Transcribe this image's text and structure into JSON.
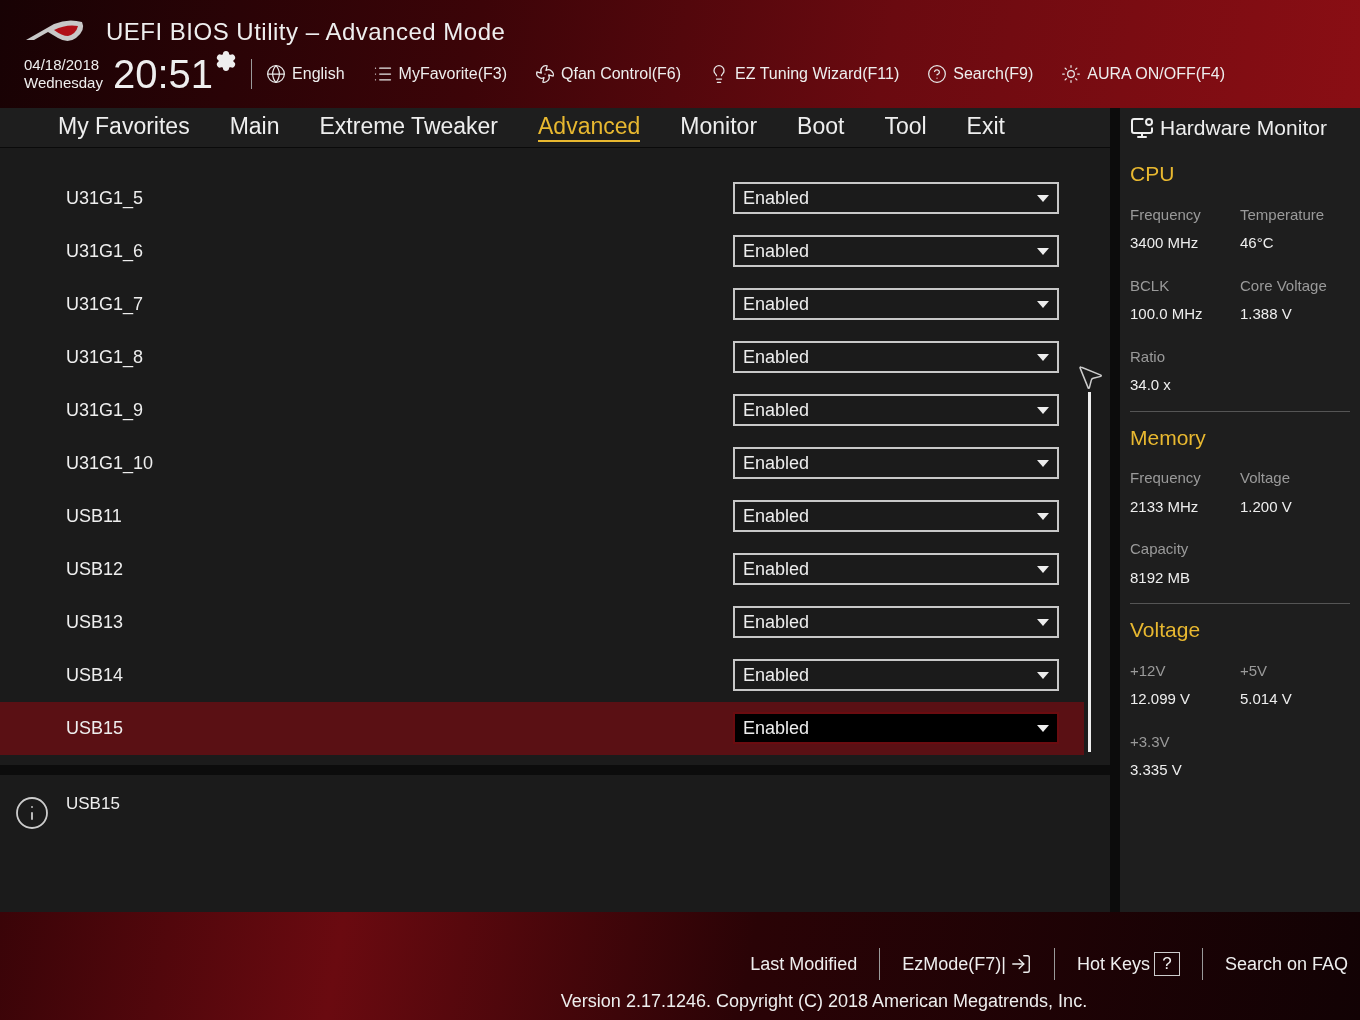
{
  "header": {
    "title": "UEFI BIOS Utility – Advanced Mode",
    "date": "04/18/2018",
    "weekday": "Wednesday",
    "time": "20:51",
    "toolbar": [
      {
        "kind": "globe",
        "label": "English"
      },
      {
        "kind": "favorite",
        "label": "MyFavorite(F3)"
      },
      {
        "kind": "fan",
        "label": "Qfan Control(F6)"
      },
      {
        "kind": "bulb",
        "label": "EZ Tuning Wizard(F11)"
      },
      {
        "kind": "search",
        "label": "Search(F9)"
      },
      {
        "kind": "aura",
        "label": "AURA ON/OFF(F4)"
      }
    ]
  },
  "tabs": [
    {
      "label": "My Favorites",
      "selected": false
    },
    {
      "label": "Main",
      "selected": false
    },
    {
      "label": "Extreme Tweaker",
      "selected": false
    },
    {
      "label": "Advanced",
      "selected": true
    },
    {
      "label": "Monitor",
      "selected": false
    },
    {
      "label": "Boot",
      "selected": false
    },
    {
      "label": "Tool",
      "selected": false
    },
    {
      "label": "Exit",
      "selected": false
    }
  ],
  "settings": [
    {
      "label": "U31G1_5",
      "value": "Enabled",
      "selected": false
    },
    {
      "label": "U31G1_6",
      "value": "Enabled",
      "selected": false
    },
    {
      "label": "U31G1_7",
      "value": "Enabled",
      "selected": false
    },
    {
      "label": "U31G1_8",
      "value": "Enabled",
      "selected": false
    },
    {
      "label": "U31G1_9",
      "value": "Enabled",
      "selected": false
    },
    {
      "label": "U31G1_10",
      "value": "Enabled",
      "selected": false
    },
    {
      "label": "USB11",
      "value": "Enabled",
      "selected": false
    },
    {
      "label": "USB12",
      "value": "Enabled",
      "selected": false
    },
    {
      "label": "USB13",
      "value": "Enabled",
      "selected": false
    },
    {
      "label": "USB14",
      "value": "Enabled",
      "selected": false
    },
    {
      "label": "USB15",
      "value": "Enabled",
      "selected": true
    }
  ],
  "help": {
    "text": "USB15"
  },
  "hardware_monitor": {
    "title": "Hardware Monitor",
    "sections": [
      {
        "title": "CPU",
        "items": [
          {
            "label": "Frequency",
            "value": "3400 MHz"
          },
          {
            "label": "Temperature",
            "value": "46°C"
          },
          {
            "label": "BCLK",
            "value": "100.0 MHz"
          },
          {
            "label": "Core Voltage",
            "value": "1.388 V"
          },
          {
            "label": "Ratio",
            "value": "34.0 x"
          }
        ]
      },
      {
        "title": "Memory",
        "items": [
          {
            "label": "Frequency",
            "value": "2133 MHz"
          },
          {
            "label": "Voltage",
            "value": "1.200 V"
          },
          {
            "label": "Capacity",
            "value": "8192 MB"
          }
        ]
      },
      {
        "title": "Voltage",
        "items": [
          {
            "label": "+12V",
            "value": "12.099 V"
          },
          {
            "label": "+5V",
            "value": "5.014 V"
          },
          {
            "label": "+3.3V",
            "value": "3.335 V"
          }
        ]
      }
    ]
  },
  "footer": {
    "links": [
      {
        "kind": "text",
        "label": "Last Modified"
      },
      {
        "kind": "ezmode",
        "label": "EzMode(F7)|"
      },
      {
        "kind": "hotkeys",
        "label": "Hot Keys",
        "key": "?"
      },
      {
        "kind": "text",
        "label": "Search on FAQ"
      }
    ],
    "version": "Version 2.17.1246. Copyright (C) 2018 American Megatrends, Inc."
  }
}
